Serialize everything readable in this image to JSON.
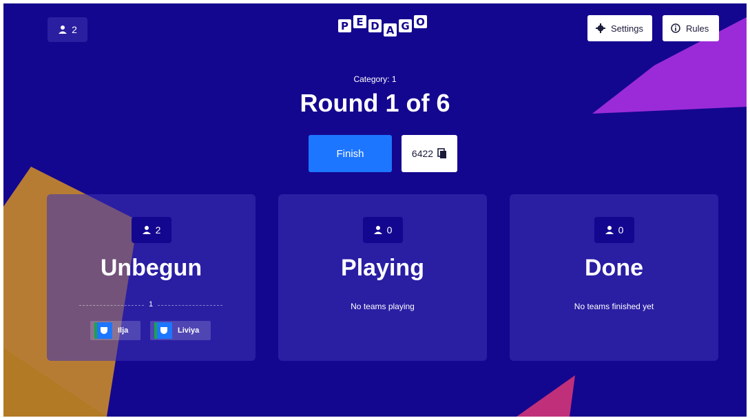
{
  "header": {
    "players_count": "2",
    "logo_letters": [
      "P",
      "E",
      "D",
      "A",
      "G",
      "O"
    ],
    "settings_label": "Settings",
    "rules_label": "Rules"
  },
  "round": {
    "category": "Category: 1",
    "title": "Round 1 of 6",
    "finish_label": "Finish",
    "game_code": "6422"
  },
  "columns": {
    "unbegun": {
      "count": "2",
      "title": "Unbegun",
      "divider_label": "1",
      "teams": [
        "Ilja",
        "Liviya"
      ]
    },
    "playing": {
      "count": "0",
      "title": "Playing",
      "empty_text": "No teams playing"
    },
    "done": {
      "count": "0",
      "title": "Done",
      "empty_text": "No teams finished yet"
    }
  },
  "colors": {
    "background": "#14078f",
    "accent": "#1d76ff",
    "panel": "#2e22a6",
    "deco_orange": "#c98a2a",
    "deco_purple": "#9b2bd9"
  },
  "icons": [
    "user-icon",
    "gear-icon",
    "info-icon",
    "copy-icon"
  ]
}
